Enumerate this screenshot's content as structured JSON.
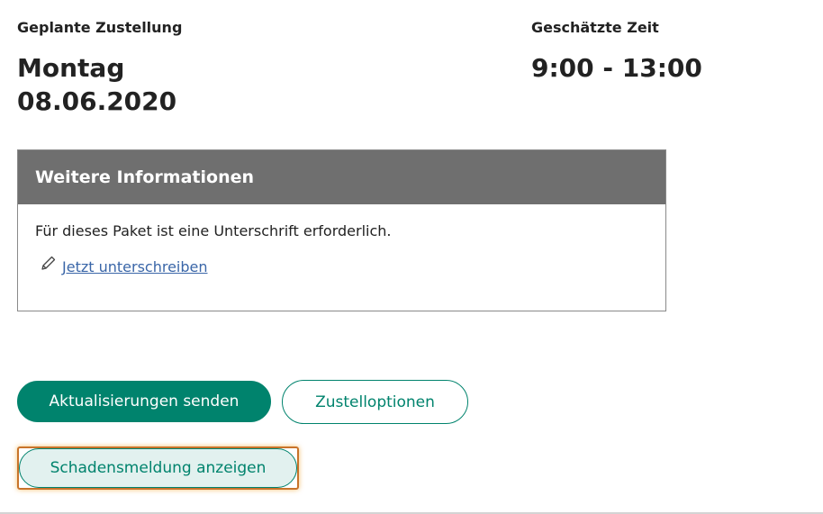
{
  "delivery": {
    "planned_label": "Geplante Zustellung",
    "planned_day": "Montag",
    "planned_date": "08.06.2020",
    "estimated_label": "Geschätzte Zeit",
    "estimated_time": "9:00 - 13:00"
  },
  "info_box": {
    "title": "Weitere Informationen",
    "text": "Für dieses Paket ist eine Unterschrift erforderlich.",
    "sign_link_label": "Jetzt unterschreiben",
    "sign_icon": "pencil-icon"
  },
  "actions": {
    "send_updates_label": "Aktualisierungen senden",
    "delivery_options_label": "Zustelloptionen",
    "damage_report_label": "Schadensmeldung anzeigen"
  },
  "colors": {
    "primary": "#00836d",
    "header_bg": "#6f6f6f",
    "link": "#3a66a8",
    "focus": "#c8732a",
    "focused_button_bg": "#e2f1ef"
  }
}
